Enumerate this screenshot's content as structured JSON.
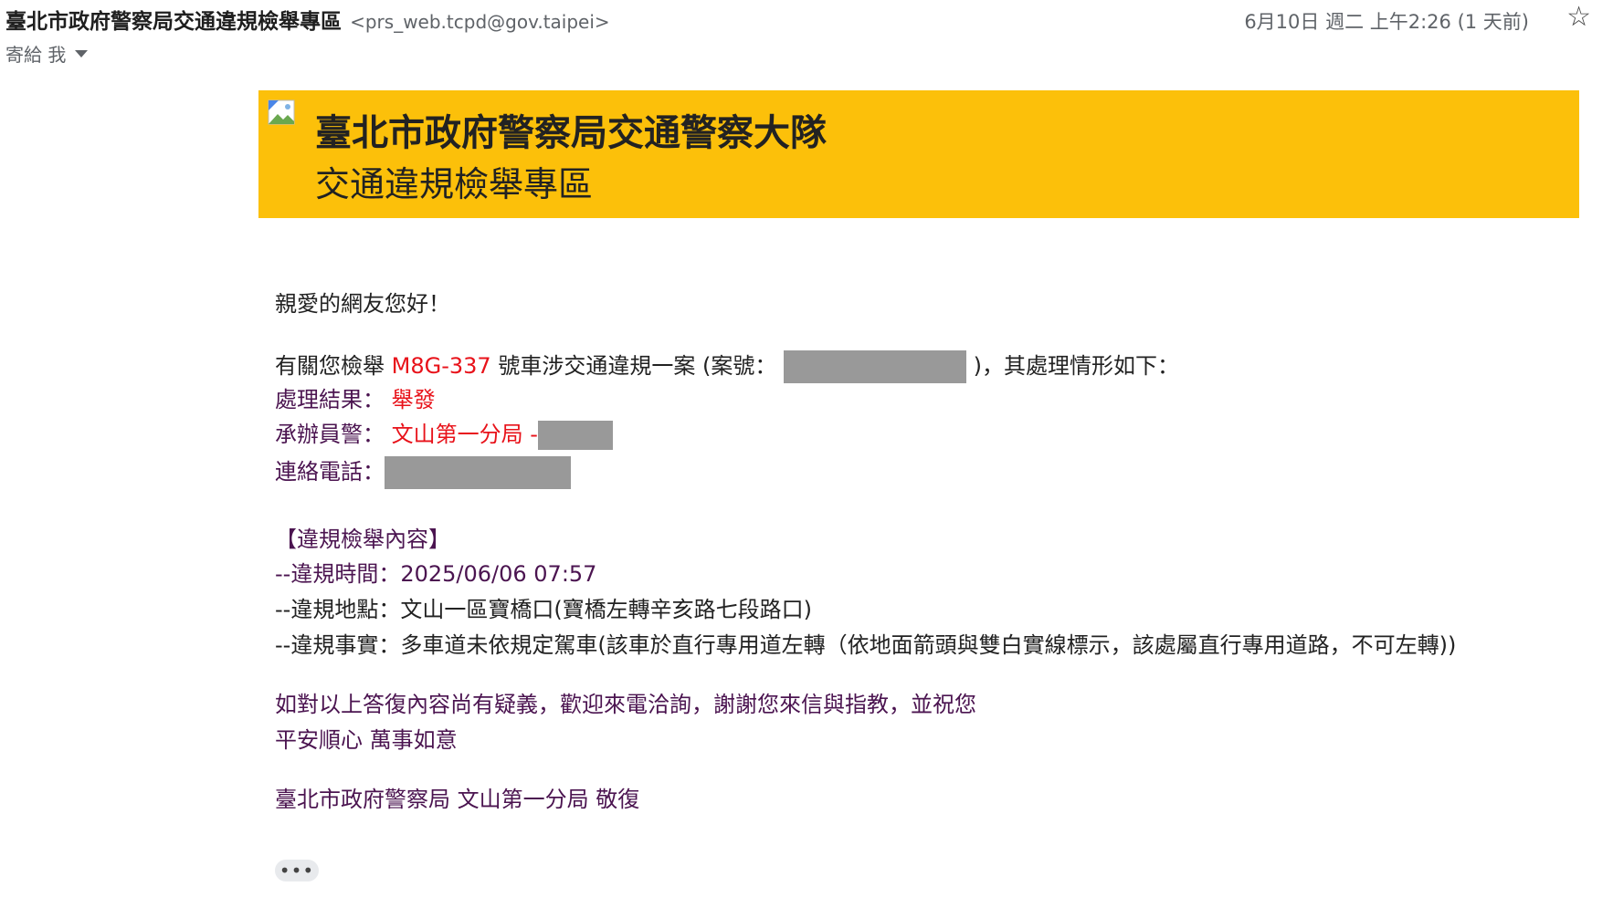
{
  "header": {
    "sender_name": "臺北市政府警察局交通違規檢舉專區",
    "sender_email": "<prs_web.tcpd@gov.taipei>",
    "to_text": "寄給 我",
    "date": "6月10日 週二 上午2:26 (1 天前)",
    "star_icon": "☆"
  },
  "banner": {
    "title1": "臺北市政府警察局交通警察大隊",
    "title2": "交通違規檢舉專區",
    "color": "#fcc00a"
  },
  "body": {
    "greeting": "親愛的網友您好！",
    "intro_prefix": "有關您檢舉",
    "plate": "M8G-337",
    "intro_mid": "號車涉交通違規一案 (案號：",
    "intro_suffix": ")，其處理情形如下：",
    "result_label": "處理結果：",
    "result_value": "舉發",
    "officer_label": "承辦員警：",
    "officer_value": "文山第一分局 -",
    "phone_label": "連絡電話：",
    "section_title": "【違規檢舉內容】",
    "time_line": "--違規時間：2025/06/06 07:57",
    "place_line": "--違規地點：文山一區寶橋口(寶橋左轉辛亥路七段路口)",
    "fact_line": "--違規事實：多車道未依規定駕車(該車於直行專用道左轉（依地面箭頭與雙白實線標示，該處屬直行專用道路，不可左轉))",
    "closing1": "如對以上答復內容尚有疑義，歡迎來電洽詢，謝謝您來信與指教，並祝您",
    "closing2": "平安順心 萬事如意",
    "signature": "臺北市政府警察局 文山第一分局 敬復",
    "more_label": "•••"
  },
  "colors": {
    "accent_red": "#e8121a",
    "purple_text": "#4b1450",
    "redaction": "#999999"
  }
}
